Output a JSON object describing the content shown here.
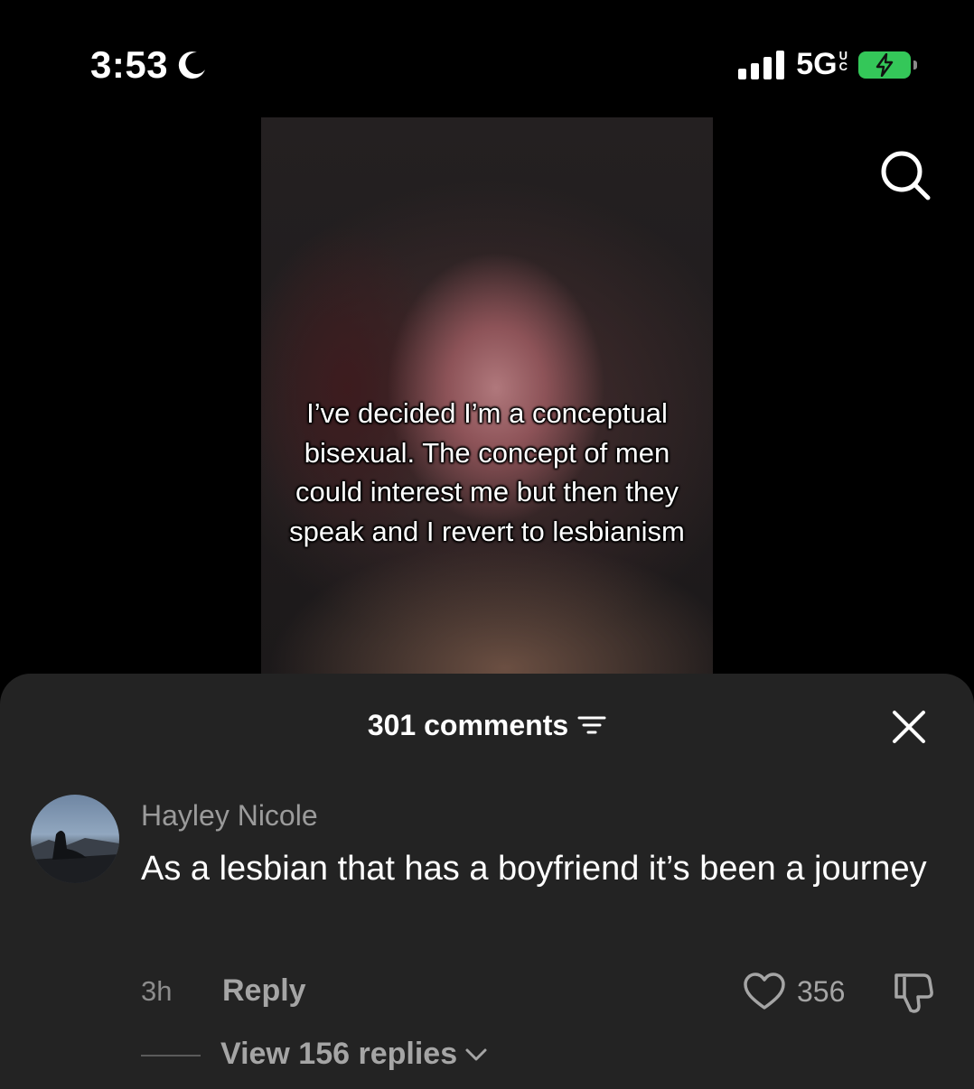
{
  "status_bar": {
    "time": "3:53",
    "network": "5G",
    "network_sup": "UC",
    "battery_color": "#34c759"
  },
  "video": {
    "caption": "I’ve decided I’m a conceptual bisexual. The concept of men could interest me but then they speak and I revert to lesbianism"
  },
  "comments_sheet": {
    "count_label": "301 comments",
    "comment": {
      "author": "Hayley Nicole",
      "text": "As a lesbian that has a boyfriend it’s been a journey",
      "time": "3h",
      "reply_label": "Reply",
      "likes": "356",
      "view_replies_label": "View 156 replies"
    }
  },
  "icons": {
    "moon": "moon-icon",
    "signal": "signal-bars-icon",
    "battery": "battery-charging-icon",
    "search": "search-icon",
    "filter": "filter-icon",
    "close": "close-icon",
    "like": "heart-icon",
    "dislike": "thumbs-down-icon",
    "chevron": "chevron-down-icon"
  }
}
